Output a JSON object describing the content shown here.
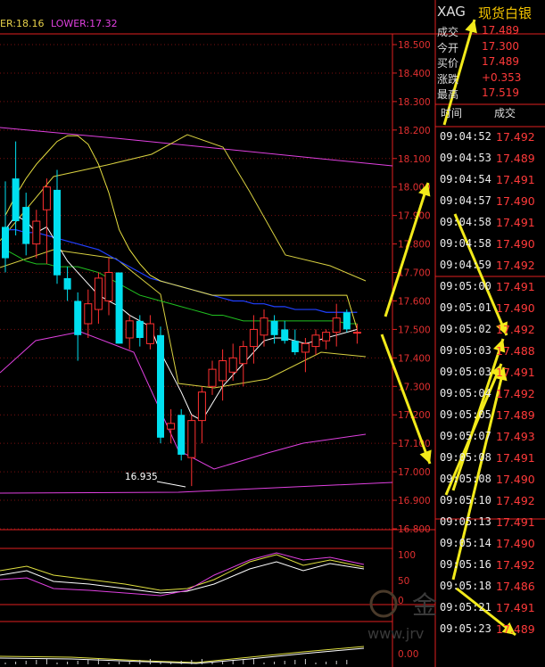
{
  "legend": {
    "upper": "ER:18.16",
    "lower": "LOWER:17.32"
  },
  "quote": {
    "symbol": "XAG",
    "name": "现货白银",
    "fields": [
      {
        "label": "成交",
        "value": "17.489"
      },
      {
        "label": "今开",
        "value": "17.300"
      },
      {
        "label": "买价",
        "value": "17.489"
      },
      {
        "label": "涨跌",
        "value": "+0.353"
      },
      {
        "label": "最高",
        "value": "17.519"
      }
    ]
  },
  "ticks_header": {
    "time": "时间",
    "price": "成交"
  },
  "ticks": [
    {
      "time": "09:04:52",
      "price": "17.492"
    },
    {
      "time": "09:04:53",
      "price": "17.489"
    },
    {
      "time": "09:04:54",
      "price": "17.491"
    },
    {
      "time": "09:04:57",
      "price": "17.490"
    },
    {
      "time": "09:04:58",
      "price": "17.491"
    },
    {
      "time": "09:04:58",
      "price": "17.490"
    },
    {
      "time": "09:04:59",
      "price": "17.492"
    },
    {
      "time": "09:05:00",
      "price": "17.491"
    },
    {
      "time": "09:05:01",
      "price": "17.490"
    },
    {
      "time": "09:05:02",
      "price": "17.492"
    },
    {
      "time": "09:05:03",
      "price": "17.488"
    },
    {
      "time": "09:05:03",
      "price": "17.491"
    },
    {
      "time": "09:05:04",
      "price": "17.492"
    },
    {
      "time": "09:05:05",
      "price": "17.489"
    },
    {
      "time": "09:05:07",
      "price": "17.493"
    },
    {
      "time": "09:05:08",
      "price": "17.491"
    },
    {
      "time": "09:05:08",
      "price": "17.490"
    },
    {
      "time": "09:05:10",
      "price": "17.492"
    },
    {
      "time": "09:05:13",
      "price": "17.491"
    },
    {
      "time": "09:05:14",
      "price": "17.490"
    },
    {
      "time": "09:05:16",
      "price": "17.492"
    },
    {
      "time": "09:05:18",
      "price": "17.486"
    },
    {
      "time": "09:05:21",
      "price": "17.491"
    },
    {
      "time": "09:05:23",
      "price": "17.489"
    }
  ],
  "price_axis": [
    "18.500",
    "18.400",
    "18.300",
    "18.200",
    "18.100",
    "18.000",
    "17.900",
    "17.800",
    "17.700",
    "17.600",
    "17.500",
    "17.400",
    "17.300",
    "17.200",
    "17.100",
    "17.000",
    "16.900",
    "16.800"
  ],
  "low_marker": "16.935",
  "osc_axis": [
    "100",
    "50",
    "0"
  ],
  "vol_axis": [
    "0.00"
  ],
  "watermark": {
    "brand": "金",
    "url": "www.jrv"
  },
  "colors": {
    "up": "#ff3030",
    "down": "#00e0f0",
    "axis": "#e02020",
    "ma5": "#ffffff",
    "ma10": "#e8e040",
    "ma20": "#20c020",
    "ma60": "#2040ff",
    "boll": "#e040e0"
  },
  "chart_data": {
    "type": "candlestick",
    "ylim": [
      16.8,
      18.55
    ],
    "candles": [
      {
        "o": 17.86,
        "h": 18.02,
        "l": 17.7,
        "c": 17.75
      },
      {
        "o": 18.03,
        "h": 18.16,
        "l": 17.83,
        "c": 17.88
      },
      {
        "o": 17.93,
        "h": 17.98,
        "l": 17.76,
        "c": 17.8
      },
      {
        "o": 17.8,
        "h": 17.92,
        "l": 17.75,
        "c": 17.88
      },
      {
        "o": 17.92,
        "h": 18.03,
        "l": 17.73,
        "c": 18.0
      },
      {
        "o": 17.99,
        "h": 18.06,
        "l": 17.66,
        "c": 17.69
      },
      {
        "o": 17.68,
        "h": 17.72,
        "l": 17.6,
        "c": 17.64
      },
      {
        "o": 17.6,
        "h": 17.63,
        "l": 17.39,
        "c": 17.48
      },
      {
        "o": 17.52,
        "h": 17.64,
        "l": 17.47,
        "c": 17.59
      },
      {
        "o": 17.57,
        "h": 17.7,
        "l": 17.52,
        "c": 17.68
      },
      {
        "o": 17.6,
        "h": 17.75,
        "l": 17.55,
        "c": 17.7
      },
      {
        "o": 17.7,
        "h": 17.62,
        "l": 17.45,
        "c": 17.45
      },
      {
        "o": 17.47,
        "h": 17.55,
        "l": 17.43,
        "c": 17.53
      },
      {
        "o": 17.53,
        "h": 17.55,
        "l": 17.44,
        "c": 17.47
      },
      {
        "o": 17.45,
        "h": 17.55,
        "l": 17.43,
        "c": 17.52
      },
      {
        "o": 17.48,
        "h": 17.51,
        "l": 17.1,
        "c": 17.12
      },
      {
        "o": 17.15,
        "h": 17.22,
        "l": 17.1,
        "c": 17.17
      },
      {
        "o": 17.2,
        "h": 17.22,
        "l": 17.04,
        "c": 17.06
      },
      {
        "o": 17.05,
        "h": 17.2,
        "l": 16.95,
        "c": 17.18
      },
      {
        "o": 17.18,
        "h": 17.3,
        "l": 17.1,
        "c": 17.28
      },
      {
        "o": 17.3,
        "h": 17.39,
        "l": 17.27,
        "c": 17.36
      },
      {
        "o": 17.32,
        "h": 17.43,
        "l": 17.25,
        "c": 17.39
      },
      {
        "o": 17.35,
        "h": 17.45,
        "l": 17.32,
        "c": 17.4
      },
      {
        "o": 17.38,
        "h": 17.46,
        "l": 17.3,
        "c": 17.44
      },
      {
        "o": 17.44,
        "h": 17.55,
        "l": 17.38,
        "c": 17.5
      },
      {
        "o": 17.48,
        "h": 17.57,
        "l": 17.44,
        "c": 17.54
      },
      {
        "o": 17.53,
        "h": 17.55,
        "l": 17.45,
        "c": 17.48
      },
      {
        "o": 17.5,
        "h": 17.53,
        "l": 17.45,
        "c": 17.46
      },
      {
        "o": 17.46,
        "h": 17.5,
        "l": 17.41,
        "c": 17.42
      },
      {
        "o": 17.42,
        "h": 17.47,
        "l": 17.35,
        "c": 17.45
      },
      {
        "o": 17.44,
        "h": 17.5,
        "l": 17.41,
        "c": 17.48
      },
      {
        "o": 17.46,
        "h": 17.5,
        "l": 17.43,
        "c": 17.49
      },
      {
        "o": 17.49,
        "h": 17.59,
        "l": 17.44,
        "c": 17.54
      },
      {
        "o": 17.56,
        "h": 17.57,
        "l": 17.49,
        "c": 17.5
      },
      {
        "o": 17.49,
        "h": 17.52,
        "l": 17.45,
        "c": 17.49
      }
    ],
    "ma5": [
      17.85,
      17.9,
      17.88,
      17.84,
      17.86,
      17.8,
      17.74,
      17.7,
      17.66,
      17.62,
      17.6,
      17.58,
      17.55,
      17.53,
      17.51,
      17.42,
      17.35,
      17.28,
      17.2,
      17.18,
      17.24,
      17.3,
      17.34,
      17.38,
      17.42,
      17.46,
      17.47,
      17.47,
      17.46,
      17.45,
      17.46,
      17.47,
      17.48,
      17.49,
      17.5
    ],
    "ma10": [
      17.9,
      17.97,
      18.03,
      18.08,
      18.12,
      18.16,
      18.18,
      18.18,
      18.15,
      18.08,
      17.98,
      17.85,
      17.78,
      17.73,
      17.69,
      17.67,
      17.66,
      17.65,
      17.64,
      17.63,
      17.62,
      17.62,
      17.62,
      17.62,
      17.62,
      17.62,
      17.62,
      17.62,
      17.62,
      17.62,
      17.62,
      17.62,
      17.62,
      17.62,
      17.5
    ],
    "ma20": [
      17.78,
      17.76,
      17.74,
      17.73,
      17.73,
      17.72,
      17.72,
      17.72,
      17.71,
      17.7,
      17.68,
      17.66,
      17.64,
      17.62,
      17.61,
      17.6,
      17.59,
      17.58,
      17.57,
      17.56,
      17.55,
      17.55,
      17.54,
      17.53,
      17.53,
      17.53,
      17.53,
      17.53,
      17.53,
      17.53,
      17.53,
      17.53,
      17.53,
      17.52,
      17.52
    ],
    "ma60": [
      17.85,
      17.85,
      17.84,
      17.84,
      17.83,
      17.82,
      17.81,
      17.8,
      17.79,
      17.78,
      17.76,
      17.74,
      17.72,
      17.7,
      17.68,
      17.67,
      17.66,
      17.65,
      17.64,
      17.63,
      17.62,
      17.61,
      17.6,
      17.6,
      17.59,
      17.59,
      17.58,
      17.58,
      17.57,
      17.57,
      17.57,
      17.56,
      17.56,
      17.56,
      17.56
    ]
  }
}
